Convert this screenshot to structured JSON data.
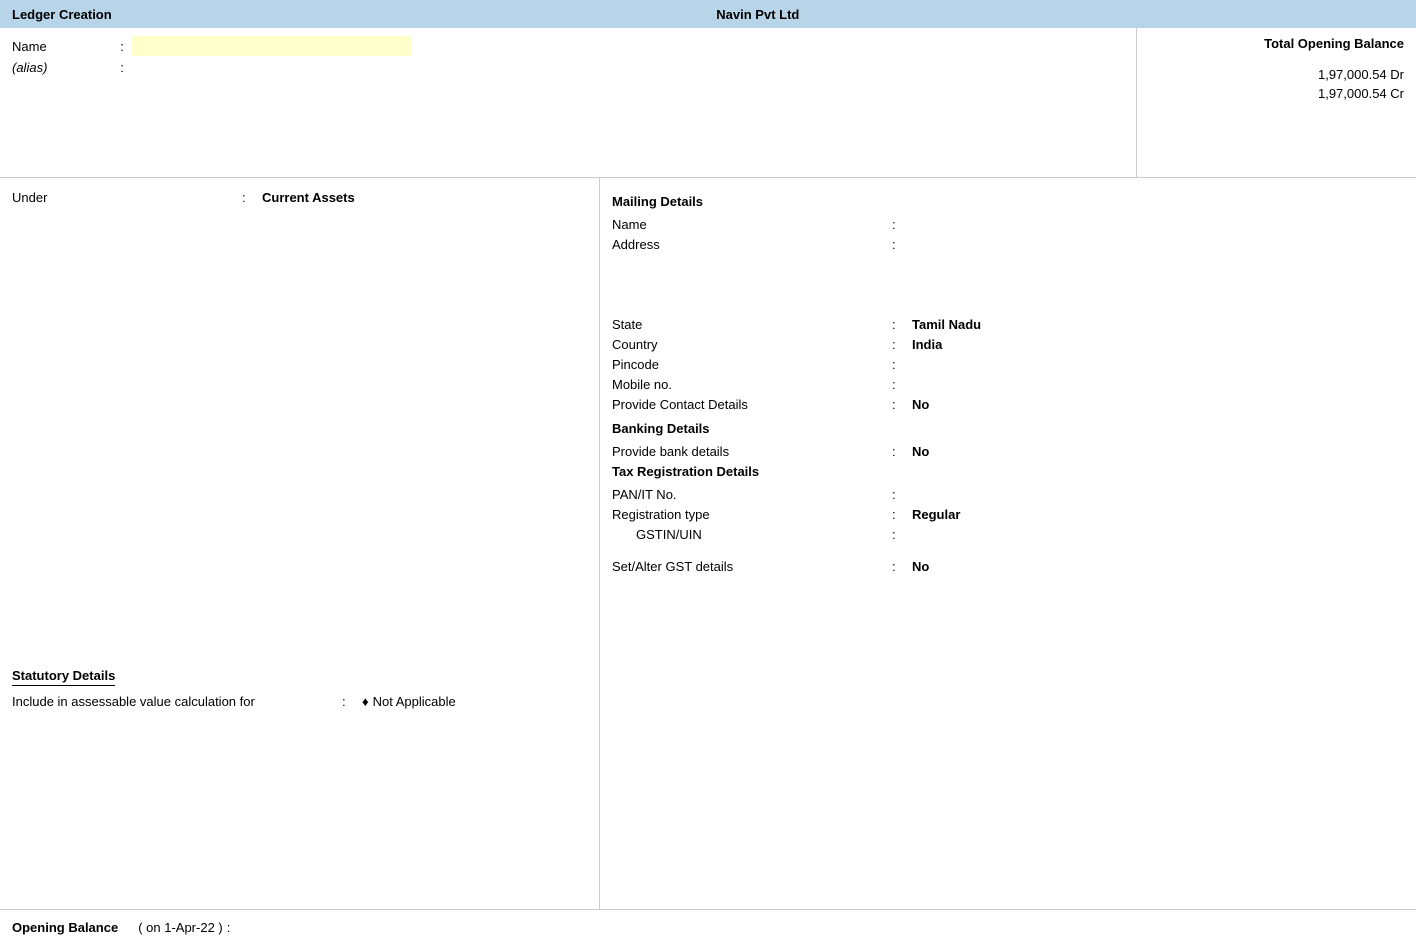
{
  "titleBar": {
    "left": "Ledger Creation",
    "center": "Navin Pvt Ltd"
  },
  "topSection": {
    "nameLabel": "Name",
    "nameValue": "",
    "aliasLabel": "(alias)",
    "aliasValue": ""
  },
  "openingBalance": {
    "title": "Total Opening Balance",
    "dr": "1,97,000.54 Dr",
    "cr": "1,97,000.54 Cr"
  },
  "leftPanel": {
    "underLabel": "Under",
    "underColon": ":",
    "underValue": "Current Assets",
    "statutoryTitle": "Statutory Details",
    "includeLabel": "Include in assessable value calculation for",
    "includeColon": ":",
    "includeDiamond": "♦",
    "includeValue": "Not Applicable"
  },
  "rightPanel": {
    "mailingTitle": "Mailing Details",
    "nameLabel": "Name",
    "nameColon": ":",
    "nameValue": "",
    "addressLabel": "Address",
    "addressColon": ":",
    "addressValue": "",
    "stateLabel": "State",
    "stateColon": ":",
    "stateValue": "Tamil Nadu",
    "countryLabel": "Country",
    "countryColon": ":",
    "countryValue": "India",
    "pincodeLabel": "Pincode",
    "pincodeColon": ":",
    "pincodeValue": "",
    "mobileLabel": "Mobile no.",
    "mobileColon": ":",
    "mobileValue": "",
    "provideContactLabel": "Provide Contact Details",
    "provideContactColon": ":",
    "provideContactValue": "No",
    "bankingTitle": "Banking Details",
    "provideBankLabel": "Provide bank details",
    "provideBankColon": ":",
    "provideBankValue": "No",
    "taxRegTitle": "Tax Registration Details",
    "panLabel": "PAN/IT No.",
    "panColon": ":",
    "panValue": "",
    "regTypeLabel": "Registration type",
    "regTypeColon": ":",
    "regTypeValue": "Regular",
    "gstinLabel": "GSTIN/UIN",
    "gstinColon": ":",
    "gstinValue": "",
    "setAlterLabel": "Set/Alter GST details",
    "setAlterColon": ":",
    "setAlterValue": "No"
  },
  "bottomBar": {
    "openingBalanceLabel": "Opening Balance",
    "onDateLabel": "( on 1-Apr-22 )",
    "colon": ":"
  }
}
